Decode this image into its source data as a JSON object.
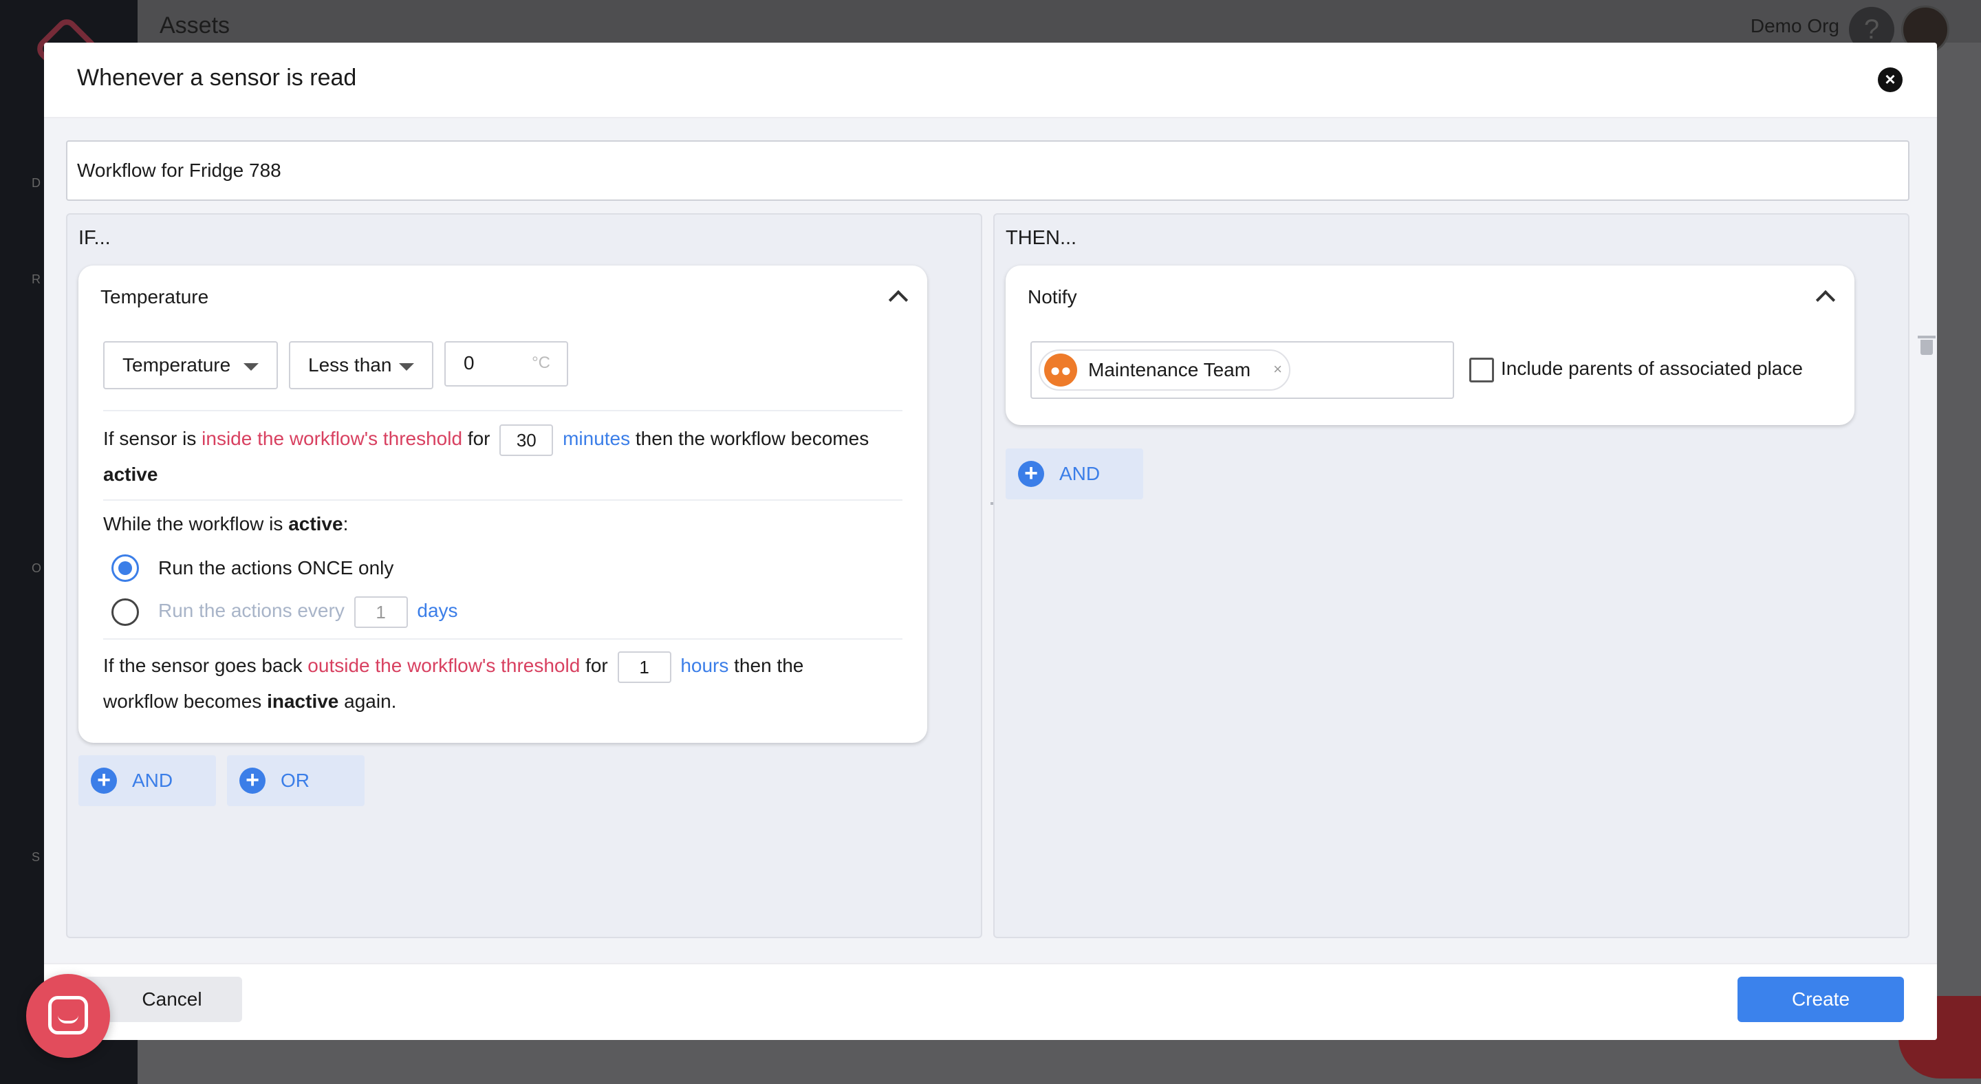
{
  "background": {
    "page_title": "Assets",
    "org_name": "Demo Org",
    "help_label": "?",
    "sidebar_letters": [
      "D",
      "R",
      "O",
      "S"
    ]
  },
  "modal": {
    "title": "Whenever a sensor is read",
    "close_label": "×",
    "workflow_name": "Workflow for Fridge 788"
  },
  "if_panel": {
    "label": "IF...",
    "card_title": "Temperature",
    "sensor_select": "Temperature",
    "operator_select": "Less than",
    "threshold_value": "0",
    "threshold_unit": "°C",
    "activate": {
      "prefix": "If sensor is",
      "highlight": "inside the workflow's threshold",
      "for": "for",
      "duration": "30",
      "unit": "minutes",
      "suffix": "then the workflow becomes",
      "state": "active"
    },
    "while": {
      "prefix": "While the workflow is",
      "state": "active",
      "suffix": ":"
    },
    "run_once_label": "Run the actions ONCE only",
    "run_every_label": "Run the actions every",
    "run_every_value": "1",
    "run_every_unit": "days",
    "deactivate": {
      "prefix": "If the sensor goes back",
      "highlight": "outside the workflow's threshold",
      "for": "for",
      "duration": "1",
      "unit": "hours",
      "suffix": "then the",
      "line2_prefix": "workflow becomes",
      "state": "inactive",
      "line2_suffix": "again."
    },
    "and_label": "AND",
    "or_label": "OR"
  },
  "then_panel": {
    "label": "THEN...",
    "card_title": "Notify",
    "recipient": "Maintenance Team",
    "chip_remove": "×",
    "include_parents_label": "Include parents of associated place",
    "and_label": "AND"
  },
  "footer": {
    "cancel_label": "Cancel",
    "create_label": "Create"
  },
  "colors": {
    "accent": "#3b7ee8",
    "highlight_red": "#d84060",
    "chip_icon": "#ee7b2a",
    "chat_fab": "#e24c5c"
  }
}
